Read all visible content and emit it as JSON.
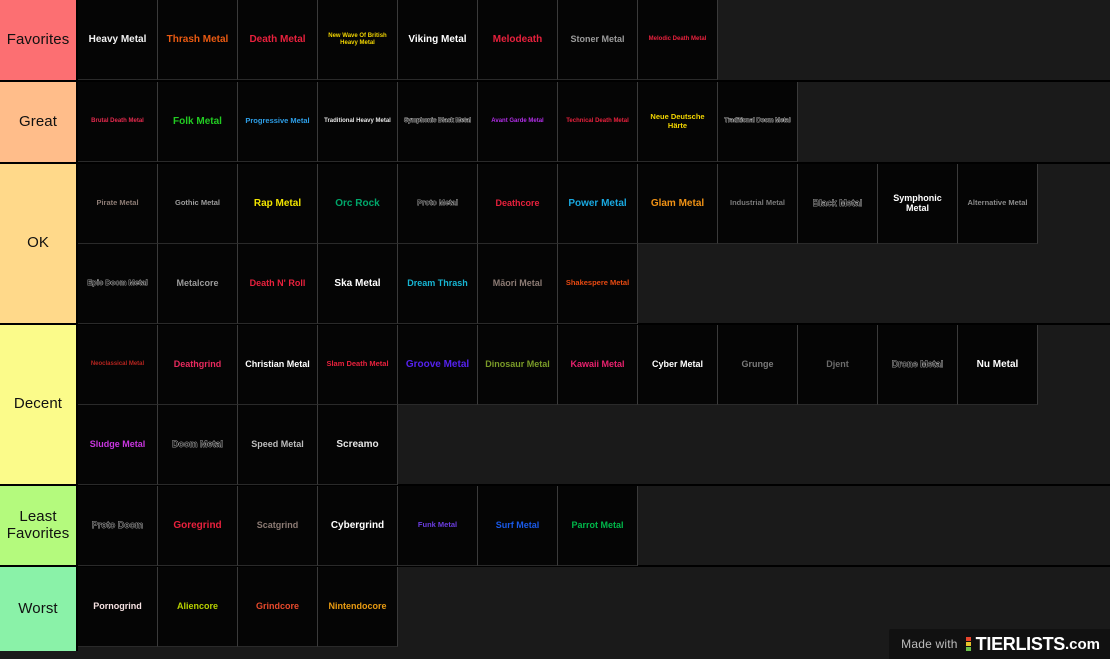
{
  "watermark": {
    "made_with": "Made with",
    "brand": "TIERLISTS",
    "tld": ".com",
    "dot_colors": [
      "#e8452c",
      "#e8c32c",
      "#6cc24a"
    ]
  },
  "theme": {
    "page_background": "#1a1a1a",
    "cell_background": "#050505",
    "grid_line": "#3a3a3a",
    "label_text": "#111111"
  },
  "tiers": [
    {
      "label": "Favorites",
      "color": "#fc6f72",
      "height": 82,
      "items": [
        {
          "label": "Heavy Metal",
          "color": "#f2f2f2",
          "size": "fs-lg",
          "outline": false
        },
        {
          "label": "Thrash Metal",
          "color": "#ea5a12",
          "size": "fs-lg",
          "outline": false
        },
        {
          "label": "Death Metal",
          "color": "#e8213d",
          "size": "fs-lg",
          "outline": false
        },
        {
          "label": "New Wave Of British Heavy Metal",
          "color": "#f2d500",
          "size": "fs-xs",
          "outline": false
        },
        {
          "label": "Viking Metal",
          "color": "#ffffff",
          "size": "fs-lg",
          "outline": false
        },
        {
          "label": "Melodeath",
          "color": "#e8213d",
          "size": "fs-lg",
          "outline": false
        },
        {
          "label": "Stoner Metal",
          "color": "#9b9b9b",
          "size": "fs-md",
          "outline": false
        },
        {
          "label": "Melodic Death Metal",
          "color": "#e8213d",
          "size": "fs-xs",
          "outline": false
        }
      ]
    },
    {
      "label": "Great",
      "color": "#ffbd8a",
      "height": 82,
      "items": [
        {
          "label": "Brutal Death Metal",
          "color": "#e62a4e",
          "size": "fs-xs",
          "outline": false
        },
        {
          "label": "Folk Metal",
          "color": "#22cc22",
          "size": "fs-lg",
          "outline": false
        },
        {
          "label": "Progressive Metal",
          "color": "#2e9fe8",
          "size": "fs-sm",
          "outline": false
        },
        {
          "label": "Traditional Heavy Metal",
          "color": "#e6e6e6",
          "size": "fs-xs",
          "outline": false
        },
        {
          "label": "Symphonic Black Metal",
          "color": "#1a1a1a",
          "size": "fs-xs",
          "outline": true
        },
        {
          "label": "Avant Garde Metal",
          "color": "#b22ee8",
          "size": "fs-xs",
          "outline": false
        },
        {
          "label": "Technical Death Metal",
          "color": "#e8213d",
          "size": "fs-xs",
          "outline": false
        },
        {
          "label": "Neue Deutsche Härte",
          "color": "#f2d500",
          "size": "fs-sm",
          "outline": false
        },
        {
          "label": "Traditional Doom Metal",
          "color": "#1a1a1a",
          "size": "fs-xs",
          "outline": true
        }
      ]
    },
    {
      "label": "OK",
      "color": "#ffd98a",
      "height": 161,
      "items": [
        {
          "label": "Pirate Metal",
          "color": "#8c7b74",
          "size": "fs-sm",
          "outline": false
        },
        {
          "label": "Gothic Metal",
          "color": "#9b9b9b",
          "size": "fs-sm",
          "outline": false
        },
        {
          "label": "Rap Metal",
          "color": "#f2e500",
          "size": "fs-lg",
          "outline": false
        },
        {
          "label": "Orc Rock",
          "color": "#00a86b",
          "size": "fs-lg",
          "outline": false
        },
        {
          "label": "Proto Metal",
          "color": "#1a1a1a",
          "size": "fs-sm",
          "outline": true
        },
        {
          "label": "Deathcore",
          "color": "#e8213d",
          "size": "fs-md",
          "outline": false
        },
        {
          "label": "Power Metal",
          "color": "#19a8e0",
          "size": "fs-lg",
          "outline": false
        },
        {
          "label": "Glam Metal",
          "color": "#f09215",
          "size": "fs-lg",
          "outline": false
        },
        {
          "label": "Industrial Metal",
          "color": "#7a7a7a",
          "size": "fs-sm",
          "outline": false
        },
        {
          "label": "Black Metal",
          "color": "#1a1a1a",
          "size": "fs-md",
          "outline": true
        },
        {
          "label": "Symphonic Metal",
          "color": "#ffffff",
          "size": "fs-md",
          "outline": false
        },
        {
          "label": "Alternative Metal",
          "color": "#8a8a8a",
          "size": "fs-sm",
          "outline": false
        },
        {
          "label": "Epic Doom Metal",
          "color": "#1a1a1a",
          "size": "fs-sm",
          "outline": true
        },
        {
          "label": "Metalcore",
          "color": "#9b9b9b",
          "size": "fs-md",
          "outline": false
        },
        {
          "label": "Death N' Roll",
          "color": "#e8213d",
          "size": "fs-md",
          "outline": false
        },
        {
          "label": "Ska Metal",
          "color": "#ffffff",
          "size": "fs-lg",
          "outline": false
        },
        {
          "label": "Dream Thrash",
          "color": "#17b6d4",
          "size": "fs-md",
          "outline": false
        },
        {
          "label": "Māori Metal",
          "color": "#8c7b74",
          "size": "fs-md",
          "outline": false
        },
        {
          "label": "Shakespere Metal",
          "color": "#e84a12",
          "size": "fs-sm",
          "outline": false
        }
      ]
    },
    {
      "label": "Decent",
      "color": "#fbfb8a",
      "height": 161,
      "items": [
        {
          "label": "Neoclassical Metal",
          "color": "#b5241f",
          "size": "fs-xs",
          "outline": false
        },
        {
          "label": "Deathgrind",
          "color": "#e82a5e",
          "size": "fs-md",
          "outline": false
        },
        {
          "label": "Christian Metal",
          "color": "#ffffff",
          "size": "fs-md",
          "outline": false
        },
        {
          "label": "Slam Death Metal",
          "color": "#e8213d",
          "size": "fs-sm",
          "outline": false
        },
        {
          "label": "Groove Metal",
          "color": "#5522ee",
          "size": "fs-lg",
          "outline": false
        },
        {
          "label": "Dinosaur Metal",
          "color": "#7a9b28",
          "size": "fs-md",
          "outline": false
        },
        {
          "label": "Kawaii Metal",
          "color": "#e8216e",
          "size": "fs-md",
          "outline": false
        },
        {
          "label": "Cyber Metal",
          "color": "#ffffff",
          "size": "fs-md",
          "outline": false
        },
        {
          "label": "Grunge",
          "color": "#7a7a7a",
          "size": "fs-md",
          "outline": false
        },
        {
          "label": "Djent",
          "color": "#6b6b6b",
          "size": "fs-md",
          "outline": false
        },
        {
          "label": "Drone Metal",
          "color": "#1a1a1a",
          "size": "fs-md",
          "outline": true
        },
        {
          "label": "Nu Metal",
          "color": "#ffffff",
          "size": "fs-lg",
          "outline": false
        },
        {
          "label": "Sludge Metal",
          "color": "#c936e0",
          "size": "fs-md",
          "outline": false
        },
        {
          "label": "Doom Metal",
          "color": "#1a1a1a",
          "size": "fs-md",
          "outline": true
        },
        {
          "label": "Speed Metal",
          "color": "#bdbdbd",
          "size": "fs-md",
          "outline": false
        },
        {
          "label": "Screamo",
          "color": "#e6e6e6",
          "size": "fs-lg",
          "outline": false
        }
      ]
    },
    {
      "label": "Least Favorites",
      "color": "#b4fa7d",
      "height": 81,
      "items": [
        {
          "label": "Proto Doom",
          "color": "#1a1a1a",
          "size": "fs-md",
          "outline": true
        },
        {
          "label": "Goregrind",
          "color": "#e8213d",
          "size": "fs-lg",
          "outline": false
        },
        {
          "label": "Scatgrind",
          "color": "#8c7b74",
          "size": "fs-md",
          "outline": false
        },
        {
          "label": "Cybergrind",
          "color": "#ffffff",
          "size": "fs-lg",
          "outline": false
        },
        {
          "label": "Funk Metal",
          "color": "#6b3de0",
          "size": "fs-sm",
          "outline": false
        },
        {
          "label": "Surf Metal",
          "color": "#1a5ae8",
          "size": "fs-md",
          "outline": false
        },
        {
          "label": "Parrot Metal",
          "color": "#00b84a",
          "size": "fs-md",
          "outline": false
        }
      ]
    },
    {
      "label": "Worst",
      "color": "#8af2a8",
      "height": 84,
      "items": [
        {
          "label": "Pornogrind",
          "color": "#f7e3e3",
          "size": "fs-md",
          "outline": false
        },
        {
          "label": "Aliencore",
          "color": "#b8d100",
          "size": "fs-md",
          "outline": false
        },
        {
          "label": "Grindcore",
          "color": "#e84a2c",
          "size": "fs-md",
          "outline": false
        },
        {
          "label": "Nintendocore",
          "color": "#e89b12",
          "size": "fs-md",
          "outline": false
        }
      ]
    }
  ]
}
